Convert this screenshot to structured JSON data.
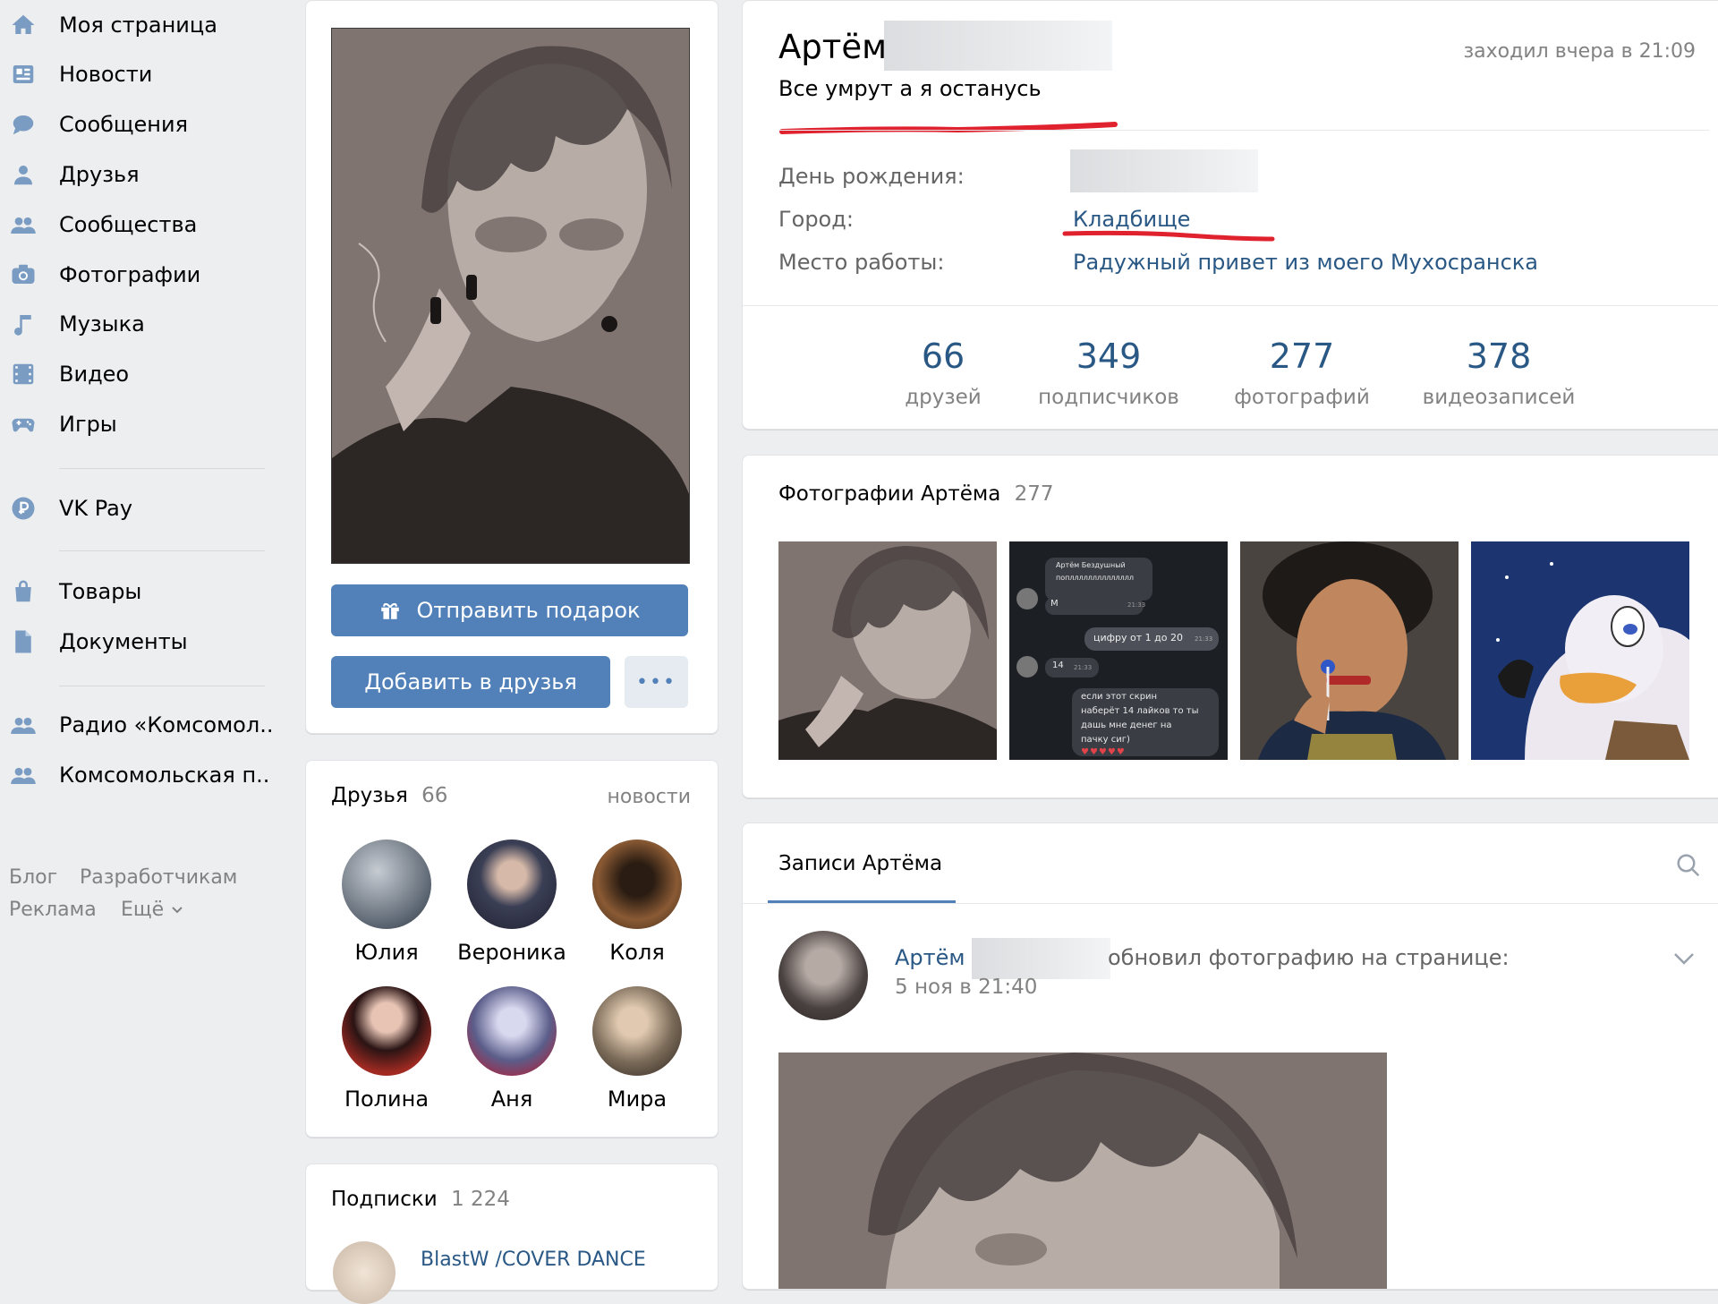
{
  "nav": {
    "items": [
      {
        "label": "Моя страница",
        "icon": "home-icon"
      },
      {
        "label": "Новости",
        "icon": "news-icon"
      },
      {
        "label": "Сообщения",
        "icon": "messages-icon"
      },
      {
        "label": "Друзья",
        "icon": "friends-icon"
      },
      {
        "label": "Сообщества",
        "icon": "communities-icon"
      },
      {
        "label": "Фотографии",
        "icon": "camera-icon"
      },
      {
        "label": "Музыка",
        "icon": "music-icon"
      },
      {
        "label": "Видео",
        "icon": "video-icon"
      },
      {
        "label": "Игры",
        "icon": "gamepad-icon"
      },
      {
        "label": "VK Pay",
        "icon": "vkpay-icon"
      },
      {
        "label": "Товары",
        "icon": "bag-icon"
      },
      {
        "label": "Документы",
        "icon": "document-icon"
      },
      {
        "label": "Радио «Комсомол..",
        "icon": "group-icon"
      },
      {
        "label": "Комсомольская п..",
        "icon": "group-icon"
      }
    ],
    "footer": {
      "blog": "Блог",
      "developers": "Разработчикам",
      "ads": "Реклама",
      "more": "Ещё"
    }
  },
  "profile": {
    "send_gift": "Отправить подарок",
    "add_friend": "Добавить в друзья",
    "more": "•••"
  },
  "friends": {
    "title": "Друзья",
    "count": "66",
    "news_link": "новости",
    "list": [
      {
        "name": "Юлия",
        "color": "#5a6470"
      },
      {
        "name": "Вероника",
        "color": "#3b3f55"
      },
      {
        "name": "Коля",
        "color": "#6b4a2e"
      },
      {
        "name": "Полина",
        "color": "#8a2a22"
      },
      {
        "name": "Аня",
        "color": "#5b5d8a"
      },
      {
        "name": "Мира",
        "color": "#7a6a58"
      }
    ]
  },
  "subscriptions": {
    "title": "Подписки",
    "count": "1 224",
    "first_item": "BlastW /COVER DANCE"
  },
  "header": {
    "name": "Артём",
    "status": "Все умрут а я останусь",
    "last_seen": "заходил вчера в 21:09"
  },
  "info": {
    "birthday_label": "День рождения:",
    "city_label": "Город:",
    "city_value": "Кладбище",
    "work_label": "Место работы:",
    "work_value": "Радужный привет из моего Мухосранска"
  },
  "counters": [
    {
      "num": "66",
      "label": "друзей"
    },
    {
      "num": "349",
      "label": "подписчиков"
    },
    {
      "num": "277",
      "label": "фотографий"
    },
    {
      "num": "378",
      "label": "видеозаписей"
    }
  ],
  "photos": {
    "title": "Фотографии Артёма",
    "count": "277"
  },
  "chat_photo": {
    "header": "Артём Бездушный",
    "line1": "поплллллллллллллл",
    "m": "M",
    "t1": "21:33",
    "msg1": "цифру от 1 до 20",
    "t2": "21:33",
    "n14": "14",
    "t3": "21:33",
    "msg2a": "если этот скрин",
    "msg2b": "наберёт 14 лайков то ты",
    "msg2c": "дашь мне денег на",
    "msg2d": "пачку сиг)"
  },
  "wall": {
    "tab": "Записи Артёма",
    "post_author": "Артём",
    "post_action": "обновил фотографию на странице:",
    "post_date": "5 ноя в 21:40"
  },
  "colors": {
    "accent": "#5181b8",
    "link": "#2a5885",
    "underline": "#e0212e"
  }
}
